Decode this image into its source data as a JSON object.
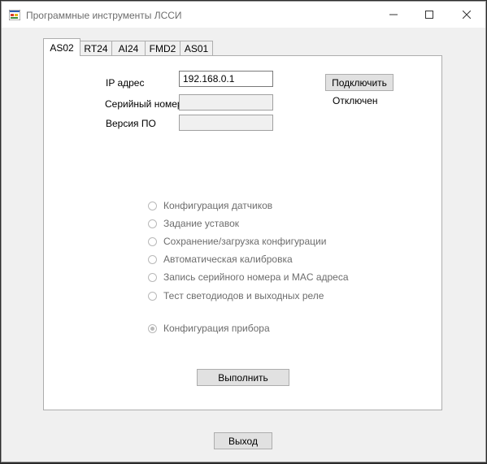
{
  "window": {
    "title": "Программные инструменты ЛССИ",
    "icon": "app-window-icon",
    "controls": {
      "minimize": "minimize-icon",
      "maximize": "maximize-icon",
      "close": "close-icon"
    }
  },
  "tabs": [
    {
      "label": "AS02",
      "active": true
    },
    {
      "label": "RT24",
      "active": false
    },
    {
      "label": "AI24",
      "active": false
    },
    {
      "label": "FMD2",
      "active": false
    },
    {
      "label": "AS01",
      "active": false
    }
  ],
  "connection": {
    "ip_label": "IP адрес",
    "ip_value": "192.168.0.1",
    "serial_label": "Серийный номер",
    "serial_value": "",
    "firmware_label": "Версия ПО",
    "firmware_value": "",
    "connect_button": "Подключить",
    "status": "Отключен"
  },
  "options": [
    {
      "label": "Конфигурация датчиков",
      "checked": false
    },
    {
      "label": "Задание уставок",
      "checked": false
    },
    {
      "label": "Сохранение/загрузка конфигурации",
      "checked": false
    },
    {
      "label": "Автоматическая калибровка",
      "checked": false
    },
    {
      "label": "Запись серийного номера и MAC адреса",
      "checked": false
    },
    {
      "label": "Тест светодиодов и выходных  реле",
      "checked": false
    },
    {
      "label": "Конфигурация прибора",
      "checked": true
    }
  ],
  "execute_button": "Выполнить",
  "exit_button": "Выход"
}
